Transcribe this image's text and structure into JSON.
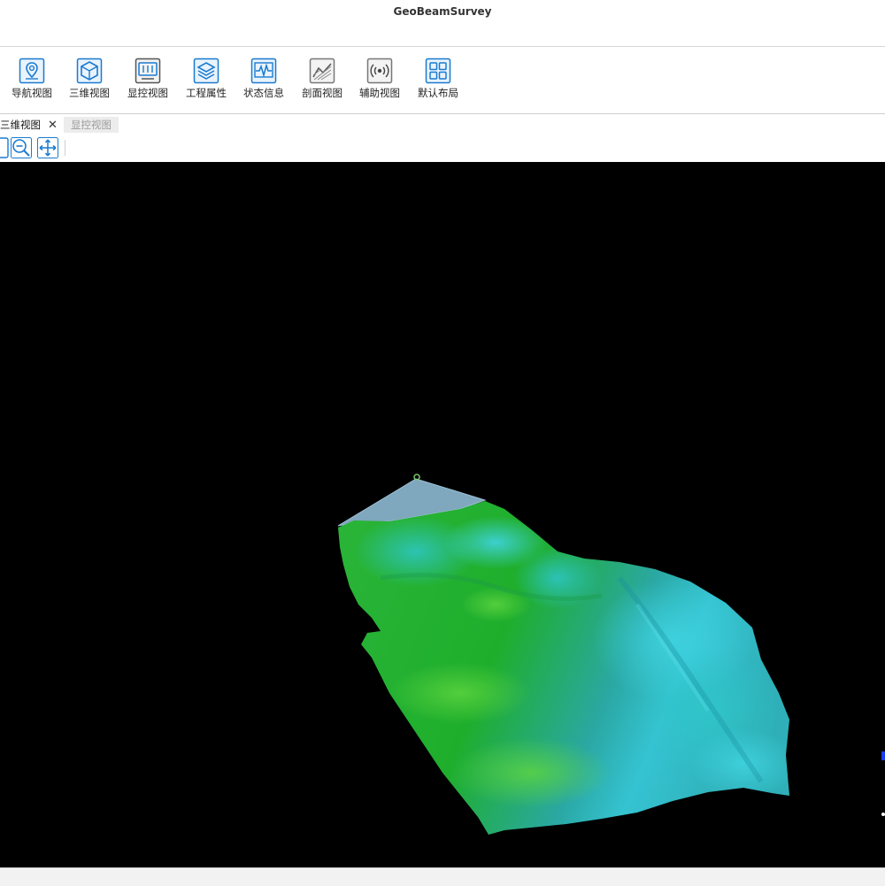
{
  "app": {
    "title": "GeoBeamSurvey"
  },
  "ribbon": {
    "buttons": [
      {
        "label": "导航视图",
        "icon": "navigation-pin-icon"
      },
      {
        "label": "三维视图",
        "icon": "cube-icon"
      },
      {
        "label": "显控视图",
        "icon": "monitor-control-icon"
      },
      {
        "label": "工程属性",
        "icon": "layers-icon"
      },
      {
        "label": "状态信息",
        "icon": "waveform-icon"
      },
      {
        "label": "剖面视图",
        "icon": "profile-hatch-icon"
      },
      {
        "label": "辅助视图",
        "icon": "signal-broadcast-icon"
      },
      {
        "label": "默认布局",
        "icon": "grid-layout-icon"
      }
    ]
  },
  "tabs": [
    {
      "label": "三维视图",
      "active": true
    },
    {
      "label": "显控视图",
      "active": false
    }
  ],
  "toolbar": {
    "tools": [
      "zoom-out-icon",
      "pan-move-icon"
    ]
  },
  "colors": {
    "accent": "#1a7bd0",
    "viewport_bg": "#000000",
    "terrain_green": "#22b534",
    "terrain_cyan": "#2fb8c8"
  }
}
